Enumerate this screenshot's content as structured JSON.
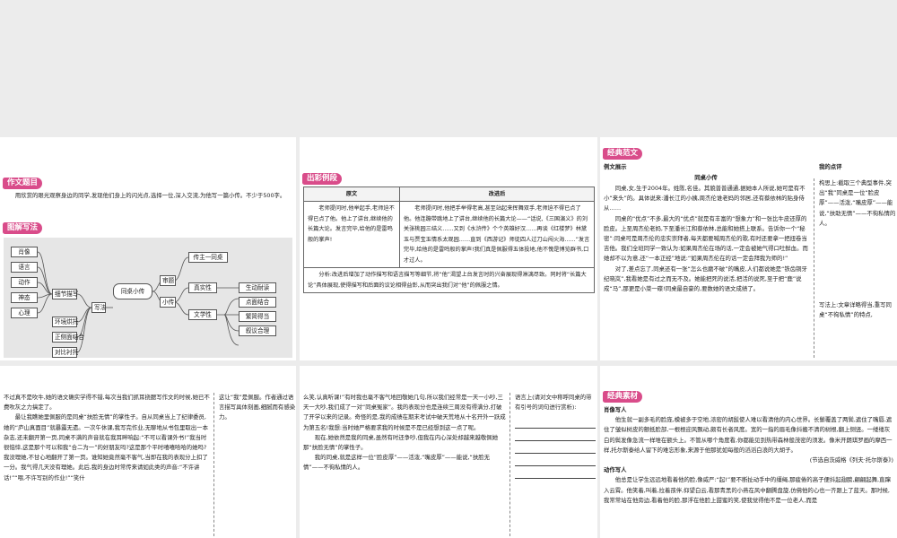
{
  "panel1": {
    "section_title": "作文题目",
    "prompt": "用欣赏的眼光观察身边的同学,发现他们身上的闪光点,选择一位,深入交流,为他写一篇小传。不少于500字。",
    "mindmap_title": "图解写法",
    "mindmap": {
      "center": "同桌小传",
      "left_methods": [
        "肖像",
        "语言",
        "动作",
        "神态",
        "心理"
      ],
      "left_mid": [
        "细节描写",
        "环境烘托",
        "正侧面结合",
        "对比衬托"
      ],
      "write": "写法",
      "topic": "审题",
      "topic_item": "传主一同桌",
      "minor": "小传",
      "minor_items": [
        "真实性",
        "文学性"
      ],
      "lit_items": [
        "生动耐读",
        "点面结合",
        "繁简得当",
        "叙议合理"
      ]
    }
  },
  "panel2": {
    "section_title": "出彩例段",
    "col_original": "原文",
    "col_revised": "改进后",
    "original": "老师提问时,他举起手,老师迫不得已点了他。他上了讲台,继续他的长篇大论。发言完毕,给他的是雷鸣般的掌声!",
    "revised": "老师提问时,他把手举得老高,甚至站起来挥舞双手,老师迫不得已点了他。他连蹦带跳地上了讲台,继续他的长篇大论——“话说,《三国演义》的刘关张桃园三结义……又到《水浒传》个个英雄好汉……再谈《红楼梦》林黛玉与贾宝玉情系太观园……直到《西游记》师徒四人过刀山闯火海……”发言完毕,给他的是雷鸣般的掌声!我们真是佩服得五体投地,他不愧是博览群书,口才过人。",
    "analysis": "分析:改进后增加了动作描写和语言描写等细节,将“他”渴望上台发言时的兴奋展现得淋漓尽致。同时将“长篇大论”具体展现,使得描写和后面的议论相得益彰,从而突出我们对“他”的佩服之情。"
  },
  "panel3": {
    "section_title": "经典范文",
    "example_label": "例文展示",
    "comment_label": "我的点评",
    "essay_title": "同桌小传",
    "paragraphs": [
      "同桌,女,生于2004年。姓陈,名佳。其貌普普通通,据她本人所说,她可是有不小“来头”的。具体说来:潘长江的小姨,周杰伦谁老妈的邻居,还有蔡依林的贴身侍从……",
      "同桌的“优点”不多,最大的“优点”就是有丰富的“想象力”和一张比牛皮还厚的脸皮。上至周杰伦老妈,下至潘长江和蔡依林,总能和她搭上联系。告诉你一个“秘密”:同桌可是周杰伦的忠实崇拜者,每天都要喊周杰伦的歌,有时还要拿一把扭卷当吉他。我们全班同学一致认为:如果周杰伦在场的话,一定会被她气得口吐鲜血。而她却不以为意,还“一本正经”地说:“如果周杰伦在的话一定会拜我为师的!”",
      "对了,差点忘了,同桌还有一张“怎么也磨不破”的嘴皮,人们都说她是“铁齿铜牙纪晓岚”,我看她是有过之而无不及。她能把死的说活,把活的说死,至于把“鹿”说成“马”,那更是小菜一碟!同桌最自豪的,要数她的语文成绩了。"
    ],
    "comment_1": "构思上:截取三个典型事件,突出“我”同桌是一位“脸皮厚”——活泼,“嘴皮厚”——能说,“扶助无情”——不徇私情的人。",
    "comment_2": "写法上:文章详略得当,重写同桌“不徇私情”的特点,"
  },
  "panel4": {
    "paragraphs": [
      "不过真不是吹牛,她的语文确实学得不错,每次当我们抓耳挠腮写作文的时候,她已不费吹灰之力搞定了。",
      "最让我瞧她里佩服的是同桌“扶脸无情”的掌性子。自从同桌当上了纪律委员,她的“庐山真面目”就暴露无遗。一次午休课,我写完作业,无聊地从书包里取出一本杂志,还未翻开第一页,同桌不满的声音就在我耳畔响起:“不可以看课外书!”我当时很恼悻,这是那个可以和我“合二为一”的好朋友吗?这是那个平时嘻嘻哈哈的她吗?我没理她,不甘心地翻开了第一页。谁知她竟然毫不客气,当即在我的表现分上扣了一分。我气得几天没有理她。此后,我的身边时常传来请如此类的声音:“不许讲话!”“喂,不许写别的作业!”“笑什"
    ],
    "comment": "这让“我”是佩服。作者通过语言描写具体刻画,细腻而有感染力。"
  },
  "panel5": {
    "paragraphs": [
      "么笑,认真听课!”有时我也毫不客气地回敬她几句,所以我们经常是一天一小吵,三天一大吵,我们成了一对“同桌冤家”。我的表现分也是连续三周没有得满分,打破了开学以来的记录。奇怪的是,我的成绩在期末考试中破天荒地从十名开外一跃成为第五名!我想:当时她严格要求我的时候是不是已经想到这一点了呢。",
      "现在,她依然是我的同桌,虽然有时还争吵,但我在内心深处却越来越敬佩她那“扶脸无情”的掌性子。",
      "我的同桌,就是这样一位“脸皮厚”——活泼,“嘴皮厚”——能说,“扶脸无情”——不徇私情的人。"
    ],
    "comment": "语言上(请对文中称呼同桌的带有引号的词句进行赏析):"
  },
  "panel6": {
    "section_title": "经典素材",
    "heading_1": "肖像写人",
    "para_1": "他生就一副多毛的脸庞,模被多于空地,浓密的胡髭使人难以看清他的内心世界。长鬃覆盖了两鬓,遮住了嘴唇,遮住了皱似树皮的颤抵脸部,一根根迎风飘动,颇有长者风度。宽的一指的眉毛像抖搬不清的树根,翻上侧竖。一缕缕灰白的鬓发像急流一样堆在额头上。不管从哪个角度看,你都能见到热带森林般茂密的须发。像米开朗琪罗画的摩西一样,托尔斯泰给人留下的难忘形象,来源于他那犹如每般的滔滔白浪的大胡子。",
    "source_1": "(节选自茨威格《列夫·托尔斯泰》)",
    "heading_2": "动作写人",
    "para_2": "他总是让学生远远地看着他的脸,像威严:“起!”要不断扯动手中的缰绳,那疲倦的高子便抖起翅膀,翩翩起舞,直蹿入云霄。他笑着,叫着,拉着孩伴,仰望白云,看那青黑的小燕在风中翻腾盘旋,仿佛他的心也一齐跟上了蓝天。那时候,我常常站在他旁边,看着他的脸,那浮在他脸上甜蜜的笑,使我觉得他不是一位老人,而是"
  }
}
